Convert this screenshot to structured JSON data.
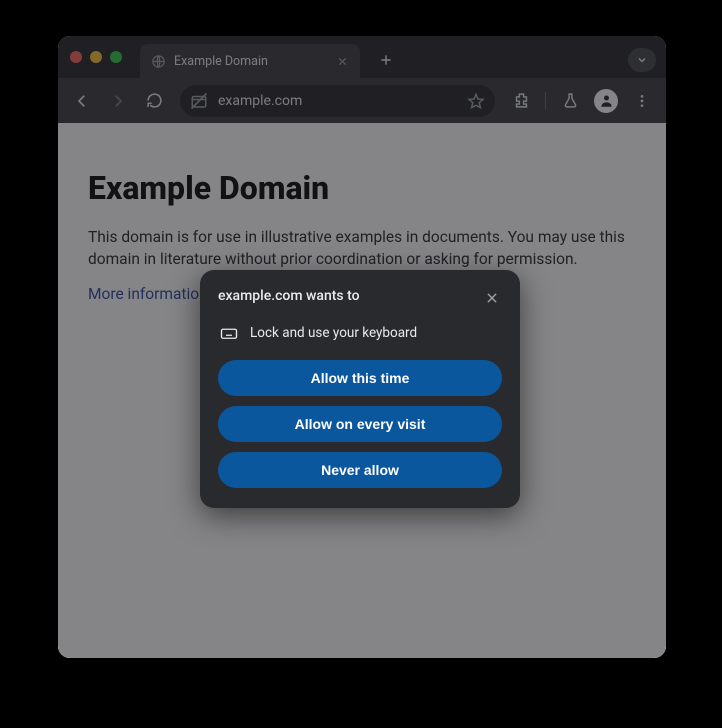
{
  "browser": {
    "tab": {
      "title": "Example Domain"
    },
    "omnibox": {
      "url": "example.com"
    }
  },
  "page": {
    "heading": "Example Domain",
    "paragraph": "This domain is for use in illustrative examples in documents. You may use this domain in literature without prior coordination or asking for permission.",
    "link_text": "More information..."
  },
  "permission_dialog": {
    "title": "example.com wants to",
    "item": "Lock and use your keyboard",
    "buttons": {
      "allow_once": "Allow this time",
      "allow_always": "Allow on every visit",
      "never": "Never allow"
    }
  }
}
